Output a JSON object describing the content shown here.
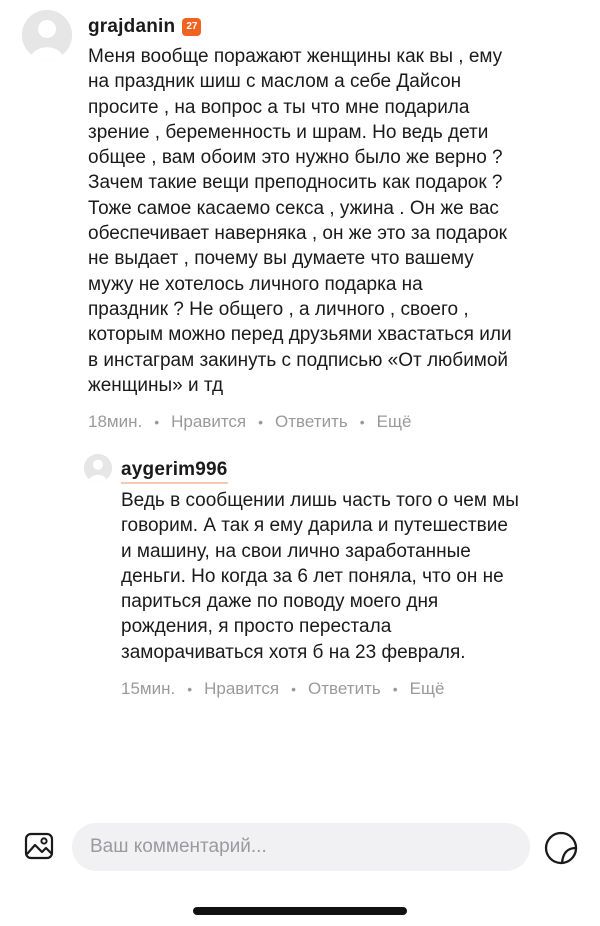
{
  "comments": [
    {
      "author": "grajdanin",
      "badge": "27",
      "text": "Меня вообще поражают женщины как вы , ему\nна праздник шиш с маслом а себе Дайсон\nпросите , на вопрос а ты что мне подарила\nзрение , беременность и шрам. Но ведь дети\nобщее , вам обоим это нужно было же верно ?\nЗачем такие вещи преподносить как подарок ?\nТоже самое касаемо секса , ужина . Он же вас\nобеспечивает наверняка , он же это за подарок\nне выдает , почему вы думаете что вашему\nмужу не хотелось личного подарка на\nпраздник ? Не общего , а личного , своего ,\nкоторым можно перед друзьями хвастаться или\nв инстаграм закинуть с подписью «От любимой\nженщины» и тд",
      "time": "18мин.",
      "like": "Нравится",
      "reply": "Ответить",
      "more": "Ещё"
    },
    {
      "author": "aygerim996",
      "text": "Ведь в сообщении лишь часть того о чем мы\nговорим. А так я ему дарила и путешествие\nи машину, на свои лично заработанные\nденьги. Но когда за 6 лет поняла, что он не\nпариться даже по поводу моего дня\nрождения, я просто перестала\nзаморачиваться хотя б на 23 февраля.",
      "time": "15мин.",
      "like": "Нравится",
      "reply": "Ответить",
      "more": "Ещё"
    }
  ],
  "composer": {
    "placeholder": "Ваш комментарий..."
  },
  "icons": {
    "attach": "image-icon",
    "sticker": "sticker-icon",
    "avatar": "default-avatar-icon"
  },
  "colors": {
    "badge": "#f26322",
    "meta": "#9a9a9a",
    "input_bg": "#f1f1f3"
  }
}
